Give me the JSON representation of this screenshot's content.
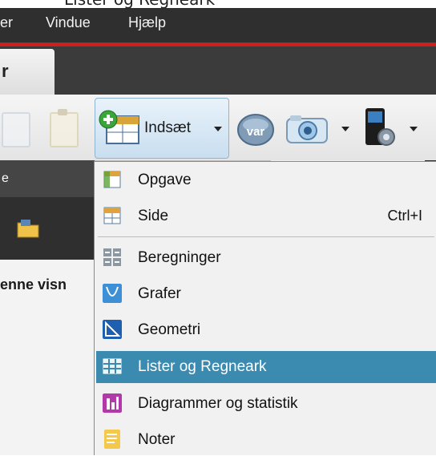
{
  "caption": {
    "text": "Lister og Regneark"
  },
  "menubar": {
    "items": [
      "er",
      "Vindue",
      "Hjælp"
    ],
    "accent_color": "#cc1f1f"
  },
  "tab": {
    "label": "r"
  },
  "toolbar": {
    "insert_label": "Indsæt",
    "var_label": "var"
  },
  "side_panel": {
    "header": "e",
    "text": "enne visn"
  },
  "dropdown": {
    "items": [
      {
        "label": "Opgave",
        "icon": "problem-icon"
      },
      {
        "label": "Side",
        "icon": "page-icon",
        "shortcut": "Ctrl+I"
      },
      {
        "label": "Beregninger",
        "icon": "calculator-icon"
      },
      {
        "label": "Grafer",
        "icon": "graphs-icon"
      },
      {
        "label": "Geometri",
        "icon": "geometry-icon"
      },
      {
        "label": "Lister og Regneark",
        "icon": "spreadsheet-icon",
        "selected": true
      },
      {
        "label": "Diagrammer og statistik",
        "icon": "data-stats-icon"
      },
      {
        "label": "Noter",
        "icon": "notes-icon"
      }
    ],
    "selected_color": "#3b8bb0"
  }
}
